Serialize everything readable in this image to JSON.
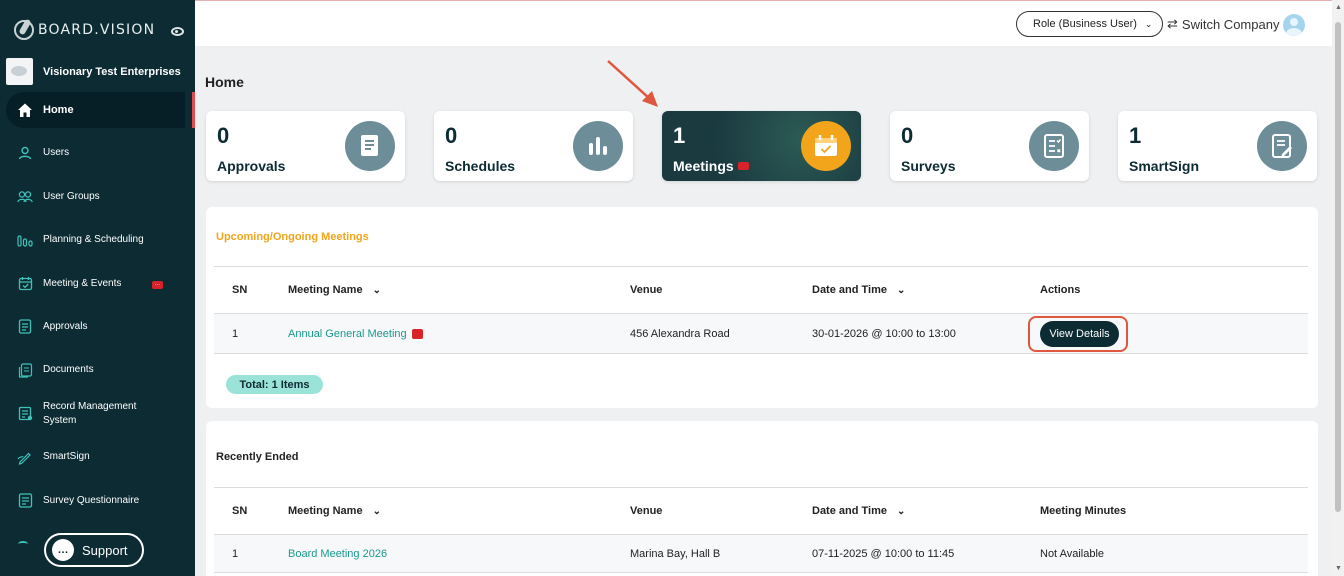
{
  "brand": {
    "name": "BOARD.VISION"
  },
  "company": {
    "name": "Visionary Test Enterprises"
  },
  "sidebar": {
    "items": [
      {
        "label": "Home",
        "icon": "home-icon"
      },
      {
        "label": "Users",
        "icon": "user-icon"
      },
      {
        "label": "User Groups",
        "icon": "users-icon"
      },
      {
        "label": "Planning & Scheduling",
        "icon": "bar-chart-icon"
      },
      {
        "label": "Meeting & Events",
        "icon": "calendar-check-icon",
        "badge": "..."
      },
      {
        "label": "Approvals",
        "icon": "document-icon"
      },
      {
        "label": "Documents",
        "icon": "documents-icon"
      },
      {
        "label": "Record Management System",
        "icon": "record-icon"
      },
      {
        "label": "SmartSign",
        "icon": "pen-icon"
      },
      {
        "label": "Survey Questionnaire",
        "icon": "checklist-icon"
      }
    ],
    "support_label": "Support"
  },
  "topbar": {
    "role_label": "Role (Business User)",
    "switch_company_label": "Switch Company"
  },
  "page": {
    "title": "Home"
  },
  "cards": [
    {
      "count": "0",
      "label": "Approvals",
      "icon": "document-icon"
    },
    {
      "count": "0",
      "label": "Schedules",
      "icon": "bar-chart-icon"
    },
    {
      "count": "1",
      "label": "Meetings",
      "icon": "calendar-icon"
    },
    {
      "count": "0",
      "label": "Surveys",
      "icon": "checklist-icon"
    },
    {
      "count": "1",
      "label": "SmartSign",
      "icon": "sign-icon"
    }
  ],
  "upcoming": {
    "title": "Upcoming/Ongoing Meetings",
    "title_color": "#f2a51a",
    "columns": [
      "SN",
      "Meeting Name",
      "Venue",
      "Date and Time",
      "Actions"
    ],
    "rows": [
      {
        "sn": "1",
        "name": "Annual General Meeting",
        "venue": "456 Alexandra Road",
        "datetime": "30-01-2026 @ 10:00 to 13:00",
        "action": "View Details"
      }
    ],
    "total": "Total: 1 Items"
  },
  "recent": {
    "title": "Recently Ended",
    "columns": [
      "SN",
      "Meeting Name",
      "Venue",
      "Date and Time",
      "Meeting Minutes"
    ],
    "rows": [
      {
        "sn": "1",
        "name": "Board Meeting 2026",
        "venue": "Marina Bay, Hall B",
        "datetime": "07-11-2025 @ 10:00 to 11:45",
        "minutes": "Not Available"
      }
    ]
  },
  "colors": {
    "sidebar": "#0c2b33",
    "accent": "#1a9a8e",
    "highlight": "#e0573f",
    "badge": "#d9222a"
  }
}
